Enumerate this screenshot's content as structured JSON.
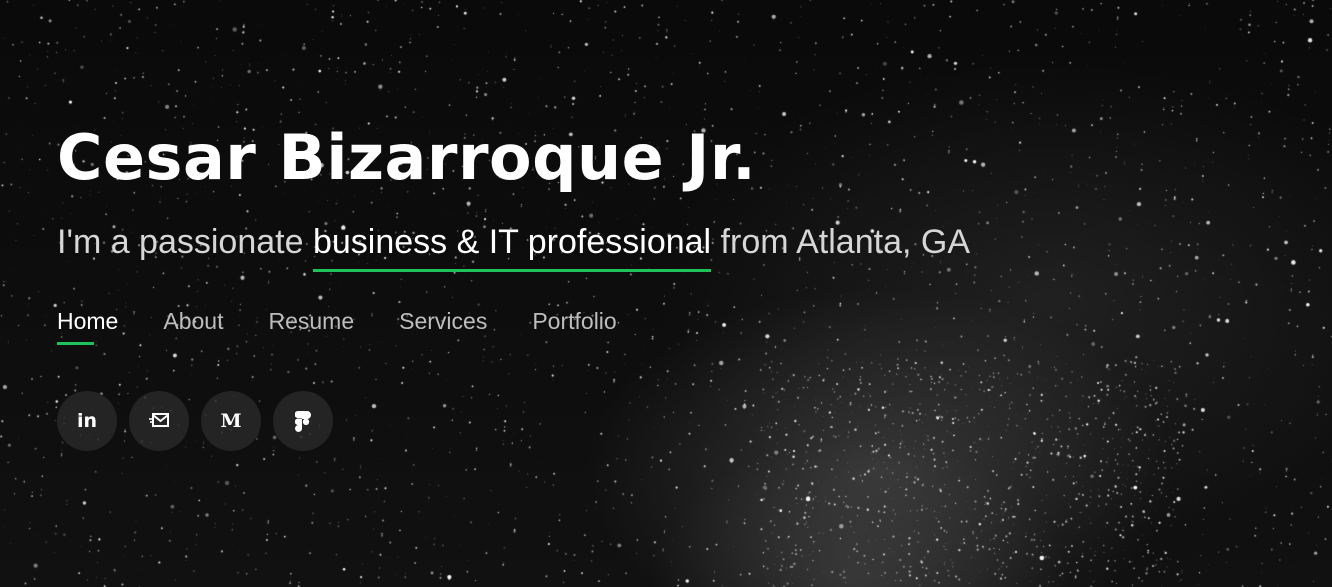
{
  "hero": {
    "name": "Cesar Bizarroque Jr.",
    "tagline": {
      "prefix": "I'm a passionate ",
      "highlight": "business & IT professional",
      "suffix": " from Atlanta, GA"
    },
    "accent_color": "#1ec15a",
    "background_color": "#050505"
  },
  "nav": {
    "items": [
      {
        "label": "Home",
        "active": true
      },
      {
        "label": "About",
        "active": false
      },
      {
        "label": "Resume",
        "active": false
      },
      {
        "label": "Services",
        "active": false
      },
      {
        "label": "Portfolio",
        "active": false
      }
    ]
  },
  "social": {
    "items": [
      {
        "icon": "linkedin-icon",
        "glyph": "in"
      },
      {
        "icon": "email-icon",
        "glyph": ""
      },
      {
        "icon": "medium-icon",
        "glyph": "M"
      },
      {
        "icon": "figma-icon",
        "glyph": ""
      }
    ]
  }
}
